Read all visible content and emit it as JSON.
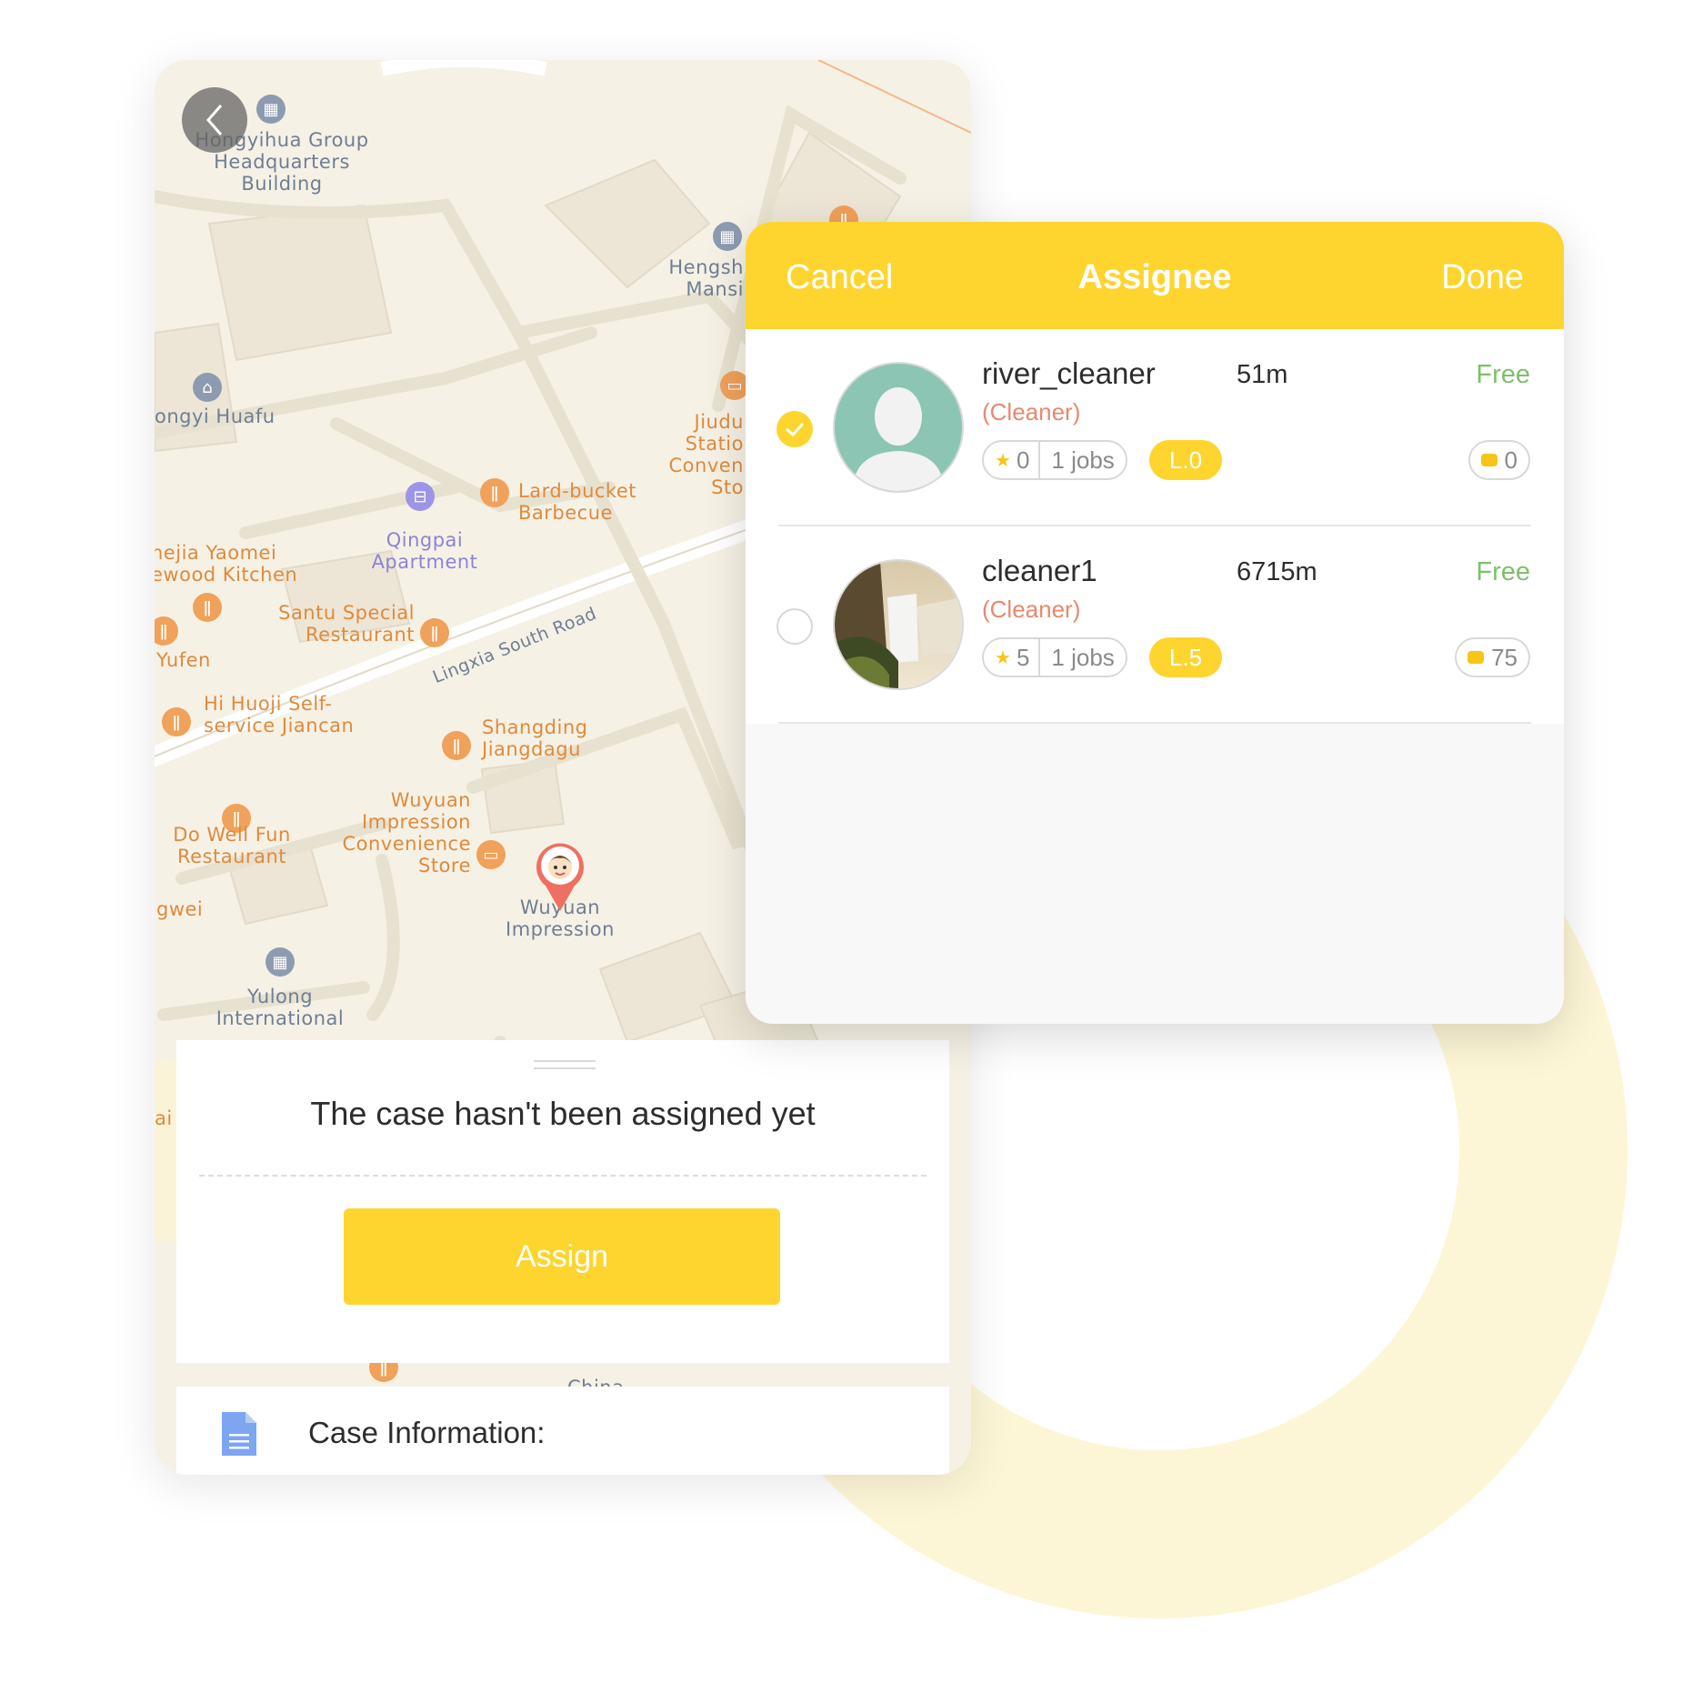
{
  "map": {
    "labels": {
      "hongyihua": "Hongyihua Group\nHeadquarters\nBuilding",
      "hengsh": "Hengsh\nMansi",
      "hongyi_huafu": "ongyi Huafu",
      "jiudu": "Jiudu\nStatio\nConven\nSto",
      "lard_bucket": "Lard-bucket\nBarbecue",
      "qingpai": "Qingpai\nApartment",
      "hejia": "hejia Yaomei\newood Kitchen",
      "santu": "Santu Special\nRestaurant",
      "yufen": "Yufen",
      "road": "Lingxia South Road",
      "huoji": "Hi Huoji Self-\nservice Jiancan",
      "shangding": "Shangding\nJiangdagu",
      "wuyuan_store": "Wuyuan\nImpression\nConvenience\nStore",
      "do_well": "Do Well Fun\nRestaurant",
      "wuyuan": "Wuyuan\nImpression",
      "gwei": "gwei",
      "yulong": "Yulong\nInternational",
      "ai": "ai",
      "china": "China"
    }
  },
  "case": {
    "status": "The case hasn't been assigned yet",
    "assign_label": "Assign",
    "info_label": "Case Information:"
  },
  "assignee": {
    "cancel": "Cancel",
    "title": "Assignee",
    "done": "Done",
    "people": [
      {
        "name": "river_cleaner",
        "distance": "51m",
        "status": "Free",
        "role": "(Cleaner)",
        "rating": "0",
        "jobs": "1 jobs",
        "level": "L.0",
        "coins": "0",
        "selected": true
      },
      {
        "name": "cleaner1",
        "distance": "6715m",
        "status": "Free",
        "role": "(Cleaner)",
        "rating": "5",
        "jobs": "1 jobs",
        "level": "L.5",
        "coins": "75",
        "selected": false
      }
    ]
  },
  "colors": {
    "accent": "#fdd52e",
    "free": "#7fbf6e",
    "role": "#e8886e",
    "map_bg": "#f6f1e5"
  }
}
